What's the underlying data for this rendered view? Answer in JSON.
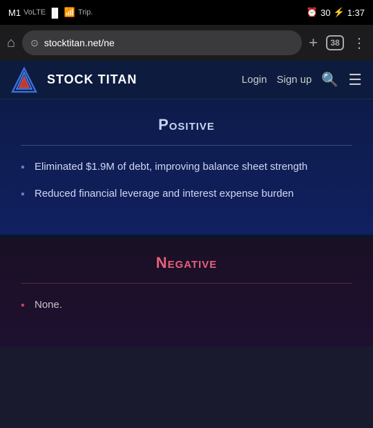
{
  "statusBar": {
    "carrier": "M1",
    "network": "VoLTE 4G",
    "time": "1:37",
    "battery": "30",
    "alarm": true
  },
  "browser": {
    "url": "stocktitan.net/ne",
    "tabCount": "38",
    "addTabLabel": "+",
    "homeLabel": "⌂",
    "menuLabel": "⋮"
  },
  "nav": {
    "logoText": "STOCK TITAN",
    "loginLabel": "Login",
    "signupLabel": "Sign up"
  },
  "positiveSectionTitle": "Positive",
  "positiveItems": [
    "Eliminated $1.9M of debt, improving balance sheet strength",
    "Reduced financial leverage and interest expense burden"
  ],
  "negativeSectionTitle": "Negative",
  "negativeItems": [
    "None."
  ]
}
